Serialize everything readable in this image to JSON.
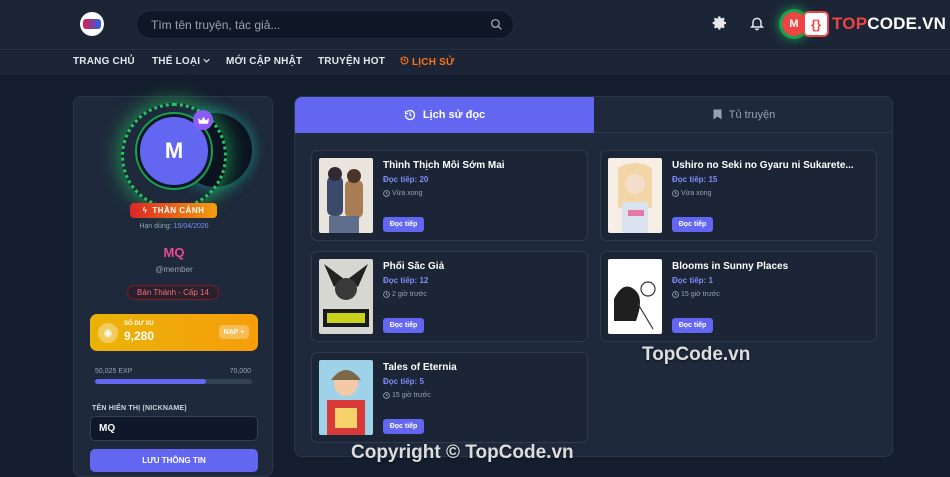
{
  "header": {
    "search_placeholder": "Tìm tên truyện, tác giả...",
    "user_initial": "M",
    "brand_badge": "{}",
    "brand_text_prefix": "TOP",
    "brand_text_suffix": "CODE.VN"
  },
  "nav": {
    "items": [
      "TRANG CHỦ",
      "THỂ LOẠI",
      "MỚI CẬP NHẬT",
      "TRUYỆN HOT",
      "LỊCH SỬ"
    ],
    "active": "LỊCH SỬ"
  },
  "profile": {
    "initial": "M",
    "rank": "THẦN CẢNH",
    "expiry_label": "Hạn dùng:",
    "expiry_date": "15/04/2026",
    "name": "MQ",
    "handle": "@member",
    "level": "Bán Thánh - Cấp 14",
    "coin_label": "SỐ DƯ XU",
    "coin_value": "9,280",
    "coin_button": "NẠP +",
    "exp_current": "50,025 EXP",
    "exp_max": "70,000",
    "exp_progress": 0.71,
    "nickname_label": "TÊN HIỂN THỊ (NICKNAME)",
    "nickname_value": "MQ",
    "save_button": "LƯU THÔNG TIN"
  },
  "tabs": {
    "history": "Lịch sử đọc",
    "bookshelf": "Tủ truyện"
  },
  "history": [
    {
      "title": "Thình Thịch Mỗi Sớm Mai",
      "progress": "Đọc tiếp: 20",
      "time": "Vừa xong",
      "button": "Đọc tiếp"
    },
    {
      "title": "Ushiro no Seki no Gyaru ni Sukarete...",
      "progress": "Đọc tiếp: 15",
      "time": "Vừa xong",
      "button": "Đọc tiếp"
    },
    {
      "title": "Phối Sắc Giả",
      "progress": "Đọc tiếp: 12",
      "time": "2 giờ trước",
      "button": "Đọc tiếp"
    },
    {
      "title": "Blooms in Sunny Places",
      "progress": "Đọc tiếp: 1",
      "time": "15 giờ trước",
      "button": "Đọc tiếp"
    },
    {
      "title": "Tales of Eternia",
      "progress": "Đọc tiếp: 5",
      "time": "15 giờ trước",
      "button": "Đọc tiếp"
    }
  ],
  "watermarks": {
    "mid": "TopCode.vn",
    "bottom": "Copyright © TopCode.vn"
  },
  "colors": {
    "accent": "#6366f1",
    "history_nav": "#f97316",
    "name": "#ec4899",
    "coin": "#eab308"
  }
}
